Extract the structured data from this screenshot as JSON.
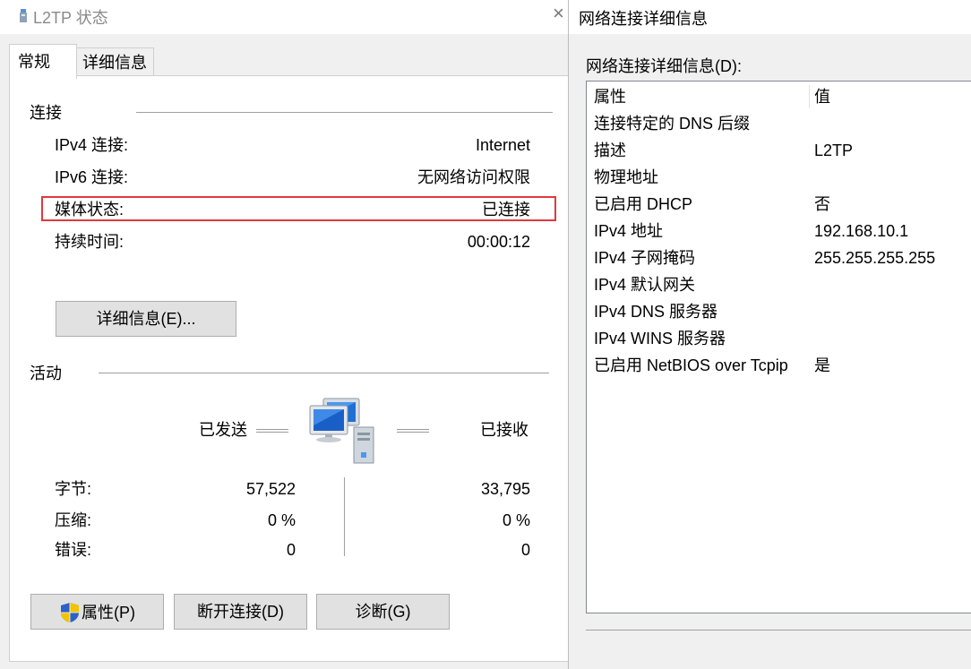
{
  "left_window": {
    "title": "L2TP 状态",
    "close_glyph": "×",
    "tabs": [
      {
        "label": "常规",
        "active": true
      },
      {
        "label": "详细信息",
        "active": false
      }
    ],
    "connection": {
      "heading": "连接",
      "rows": [
        {
          "label": "IPv4 连接:",
          "value": "Internet"
        },
        {
          "label": "IPv6 连接:",
          "value": "无网络访问权限"
        },
        {
          "label": "媒体状态:",
          "value": "已连接",
          "highlighted": true
        },
        {
          "label": "持续时间:",
          "value": "00:00:12"
        }
      ],
      "details_button": "详细信息(E)..."
    },
    "activity": {
      "heading": "活动",
      "sent_label": "已发送",
      "received_label": "已接收",
      "rows": [
        {
          "label": "字节:",
          "sent": "57,522",
          "received": "33,795"
        },
        {
          "label": "压缩:",
          "sent": "0 %",
          "received": "0 %"
        },
        {
          "label": "错误:",
          "sent": "0",
          "received": "0"
        }
      ]
    },
    "buttons": {
      "properties": "属性(P)",
      "disconnect": "断开连接(D)",
      "diagnose": "诊断(G)"
    },
    "highlight_color": "#e0393e"
  },
  "right_window": {
    "title": "网络连接详细信息",
    "list_label": "网络连接详细信息(D):",
    "columns": [
      "属性",
      "值"
    ],
    "rows": [
      {
        "property": "连接特定的 DNS 后缀",
        "value": ""
      },
      {
        "property": "描述",
        "value": "L2TP"
      },
      {
        "property": "物理地址",
        "value": ""
      },
      {
        "property": "已启用 DHCP",
        "value": "否"
      },
      {
        "property": "IPv4 地址",
        "value": "192.168.10.1"
      },
      {
        "property": "IPv4 子网掩码",
        "value": "255.255.255.255"
      },
      {
        "property": "IPv4 默认网关",
        "value": ""
      },
      {
        "property": "IPv4 DNS 服务器",
        "value": ""
      },
      {
        "property": "IPv4 WINS 服务器",
        "value": ""
      },
      {
        "property": "已启用 NetBIOS over Tcpip",
        "value": "是"
      }
    ]
  }
}
